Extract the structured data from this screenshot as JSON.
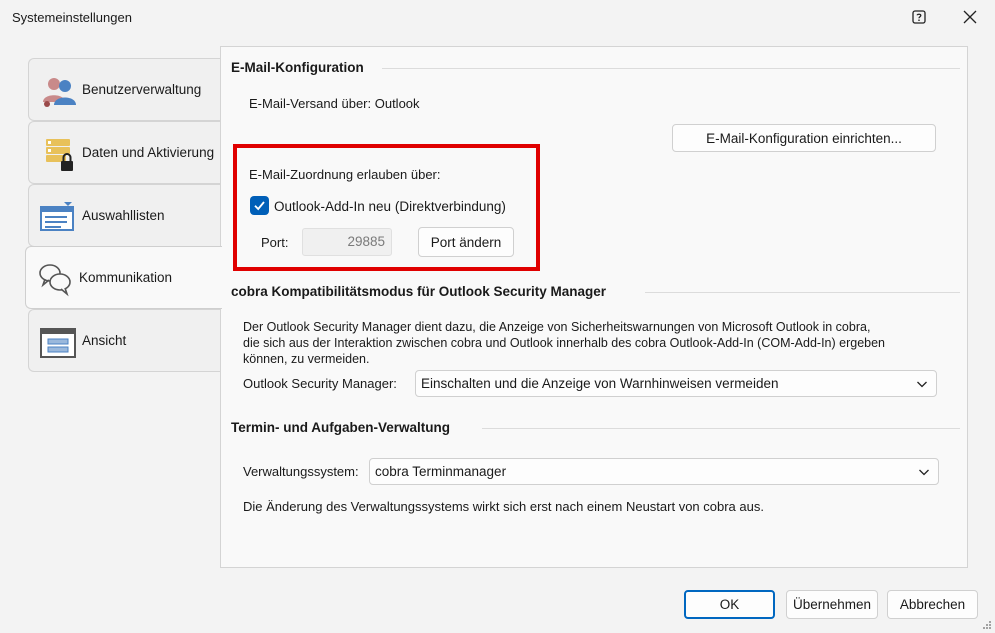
{
  "window": {
    "title": "Systemeinstellungen"
  },
  "tabs": [
    {
      "label": "Benutzerverwaltung",
      "icon": "users-icon"
    },
    {
      "label": "Daten und Aktivierung",
      "icon": "database-lock-icon"
    },
    {
      "label": "Auswahllisten",
      "icon": "list-dropdown-icon"
    },
    {
      "label": "Kommunikation",
      "icon": "chat-bubbles-icon"
    },
    {
      "label": "Ansicht",
      "icon": "window-layout-icon"
    }
  ],
  "active_tab": "Kommunikation",
  "email": {
    "section_title": "E-Mail-Konfiguration",
    "send_via": "E-Mail-Versand über: Outlook",
    "setup_button": "E-Mail-Konfiguration einrichten...",
    "assignment_label": "E-Mail-Zuordnung erlauben über:",
    "addin_checkbox_label": "Outlook-Add-In neu (Direktverbindung)",
    "addin_checked": true,
    "port_label": "Port:",
    "port_value": "29885",
    "port_button": "Port ändern"
  },
  "compat": {
    "section_title": "cobra Kompatibilitätsmodus für Outlook Security Manager",
    "description_lines": [
      "Der Outlook Security Manager dient dazu, die Anzeige von Sicherheitswarnungen von Microsoft Outlook in cobra,",
      "die sich aus der Interaktion zwischen cobra und Outlook innerhalb des cobra Outlook-Add-In (COM-Add-In) ergeben",
      "können, zu vermeiden."
    ],
    "manager_label": "Outlook Security Manager:",
    "manager_value": "Einschalten und die Anzeige von Warnhinweisen vermeiden"
  },
  "tasks": {
    "section_title": "Termin- und Aufgaben-Verwaltung",
    "system_label": "Verwaltungssystem:",
    "system_value": "cobra Terminmanager",
    "note": "Die Änderung des Verwaltungssystems wirkt sich erst nach einem Neustart von cobra aus."
  },
  "footer": {
    "ok": "OK",
    "apply": "Übernehmen",
    "cancel": "Abbrechen"
  },
  "colors": {
    "accent": "#005fb8",
    "highlight_box": "#e00000"
  }
}
